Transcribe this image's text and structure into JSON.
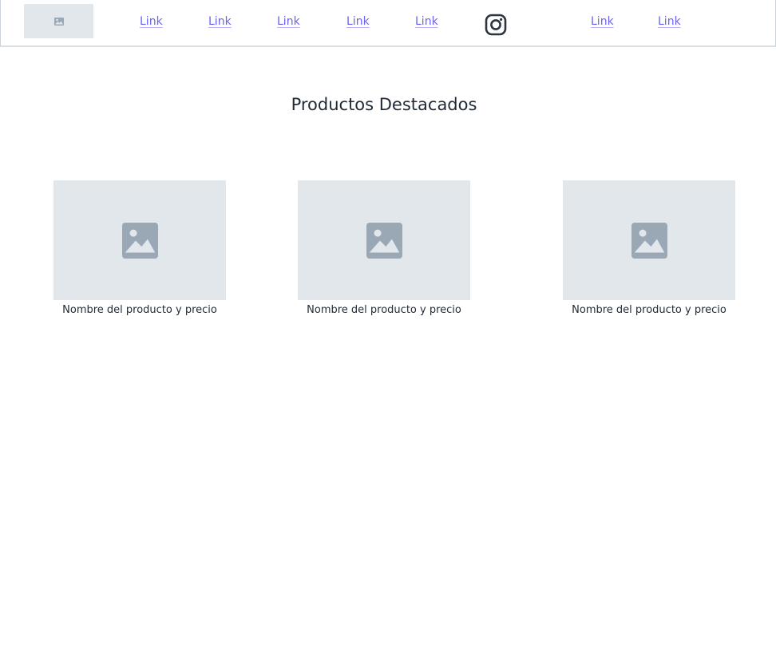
{
  "navbar": {
    "logo_icon": "image-placeholder-icon",
    "links_left": [
      {
        "label": "Link"
      },
      {
        "label": "Link"
      },
      {
        "label": "Link"
      },
      {
        "label": "Link"
      },
      {
        "label": "Link"
      }
    ],
    "social_icon": "instagram-icon",
    "links_right": [
      {
        "label": "Link"
      },
      {
        "label": "Link"
      }
    ]
  },
  "main": {
    "title": "Productos Destacados",
    "products": [
      {
        "caption": "Nombre del producto y precio",
        "image_icon": "image-placeholder-icon"
      },
      {
        "caption": "Nombre del producto y precio",
        "image_icon": "image-placeholder-icon"
      },
      {
        "caption": "Nombre del producto y precio",
        "image_icon": "image-placeholder-icon"
      }
    ]
  },
  "colors": {
    "link": "#6b63f0",
    "placeholder_bg": "#e2e7ec",
    "placeholder_icon": "#9aa8b6",
    "text": "#1f2a37"
  }
}
